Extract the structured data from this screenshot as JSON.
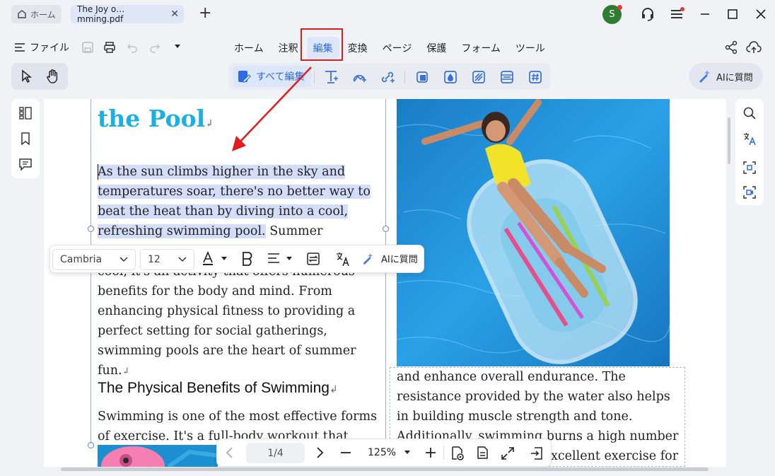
{
  "tabs": {
    "home_label": "ホーム",
    "doc_label": "The Joy o…mming.pdf",
    "close": "✕",
    "new": "+"
  },
  "account": {
    "avatar_letter": "S",
    "avatar_color": "#2e7d32"
  },
  "menu": {
    "file_label": "ファイル",
    "items": [
      "ホーム",
      "注釈",
      "編集",
      "変換",
      "ページ",
      "保護",
      "フォーム",
      "ツール"
    ],
    "active": "編集"
  },
  "toolbar": {
    "edit_all_label": "すべて編集",
    "ai_label": "AIに質問"
  },
  "document": {
    "heading": "the Pool",
    "para1_highlighted": [
      "As the sun climbs higher in the sky and",
      "temperatures soar, there's no better way to",
      "beat the heat than by diving into a cool,",
      "refreshing swimming pool."
    ],
    "para1_tail": " Summer",
    "para1_partial": "cool, it's an activity that offers numerous",
    "para1_rest": [
      "benefits for the body and mind. From",
      "enhancing physical fitness to providing a",
      "perfect setting for social gatherings,",
      "swimming pools are the heart of summer fun."
    ],
    "subheading": "The Physical Benefits of Swimming",
    "para2": [
      "Swimming is one of the most effective forms",
      "of exercise. It's a full-body workout that"
    ],
    "right_col": [
      "and enhance overall endurance. The",
      "resistance provided by the water also helps",
      "in building muscle strength and tone.",
      "Additionally, swimming burns a high number",
      "xcellent exercise for"
    ],
    "return_mark": "↲"
  },
  "format_bar": {
    "font": "Cambria",
    "size": "12",
    "ai_label": "AIに質問"
  },
  "page_nav": {
    "page": "1/4",
    "zoom": "125%"
  },
  "colors": {
    "accent": "#2d6be6",
    "heading": "#1ab0e4",
    "highlight": "#d3dcf8",
    "annotation_red": "#e21b1b"
  }
}
